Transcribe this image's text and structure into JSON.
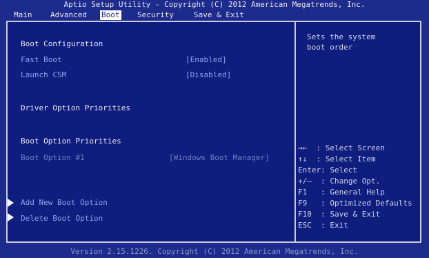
{
  "header": {
    "title": "Aptio Setup Utility - Copyright (C) 2012 American Megatrends, Inc."
  },
  "menu": {
    "items": [
      {
        "label": "Main",
        "active": false
      },
      {
        "label": "Advanced",
        "active": false
      },
      {
        "label": "Boot",
        "active": true
      },
      {
        "label": "Security",
        "active": false
      },
      {
        "label": "Save & Exit",
        "active": false
      }
    ]
  },
  "boot": {
    "config_heading": "Boot Configuration",
    "fast_boot": {
      "label": "Fast Boot",
      "value": "[Enabled]"
    },
    "launch_csm": {
      "label": "Launch CSM",
      "value": "[Disabled]"
    },
    "driver_heading": "Driver Option Priorities",
    "boot_option_heading": "Boot Option Priorities",
    "boot_option_1": {
      "label": "Boot Option #1",
      "value": "[Windows Boot Manager]"
    },
    "add_new": "Add New Boot Option",
    "delete": "Delete Boot Option"
  },
  "help": {
    "line1": "Sets the system",
    "line2": "boot order"
  },
  "keys": [
    {
      "key": "→←",
      "sep": "  : ",
      "action": "Select Screen"
    },
    {
      "key": "↑↓",
      "sep": "  : ",
      "action": "Select Item"
    },
    {
      "key": "Enter",
      "sep": ": ",
      "action": "Select"
    },
    {
      "key": "+/–",
      "sep": "  : ",
      "action": "Change Opt."
    },
    {
      "key": "F1",
      "sep": "   : ",
      "action": "General Help"
    },
    {
      "key": "F9",
      "sep": "   : ",
      "action": "Optimized Defaults"
    },
    {
      "key": "F10",
      "sep": "  : ",
      "action": "Save & Exit"
    },
    {
      "key": "ESC",
      "sep": "  : ",
      "action": "Exit"
    }
  ],
  "footer": {
    "text": "Version 2.15.1226. Copyright (C) 2012 American Megatrends, Inc."
  }
}
